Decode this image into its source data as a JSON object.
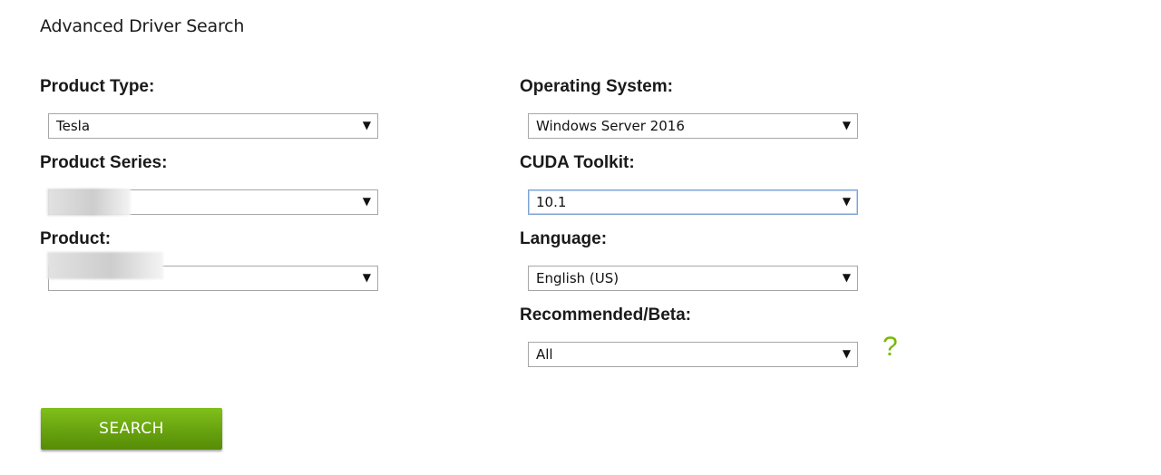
{
  "page": {
    "title": "Advanced Driver Search"
  },
  "left_column": {
    "product_type": {
      "label": "Product Type:",
      "value": "Tesla"
    },
    "product_series": {
      "label": "Product Series:",
      "value": ""
    },
    "product": {
      "label": "Product:",
      "value": ""
    }
  },
  "right_column": {
    "operating_system": {
      "label": "Operating System:",
      "value": "Windows Server 2016"
    },
    "cuda_toolkit": {
      "label": "CUDA Toolkit:",
      "value": "10.1"
    },
    "language": {
      "label": "Language:",
      "value": "English (US)"
    },
    "recommended_beta": {
      "label": "Recommended/Beta:",
      "value": "All"
    }
  },
  "dropdown_arrow": "▼",
  "help": {
    "glyph": "?",
    "icon": "question-mark-icon"
  },
  "search_button": {
    "label": "SEARCH"
  },
  "colors": {
    "accent_green": "#76b900",
    "button_green": "#6aa510",
    "focus_border": "#7ea3d6"
  }
}
